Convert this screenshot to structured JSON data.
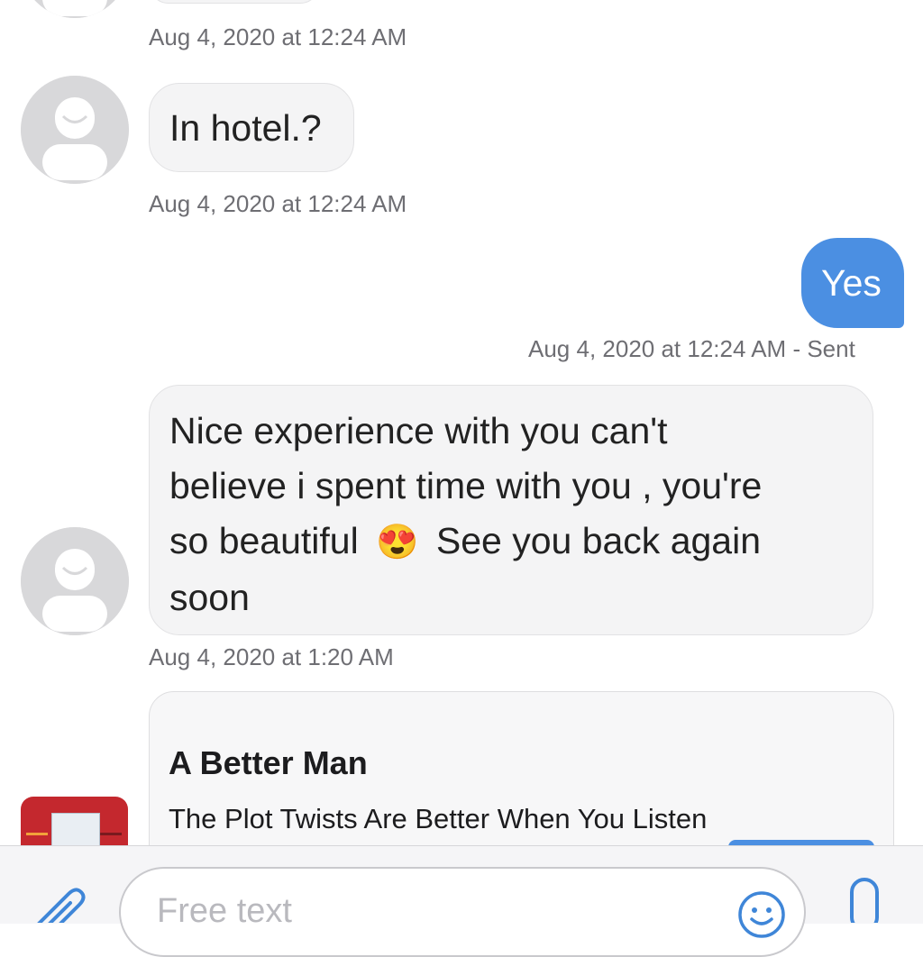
{
  "messages": [
    {
      "timestamp": "Aug 4, 2020 at 12:24 AM"
    },
    {
      "text": "In hotel.?",
      "timestamp": "Aug 4, 2020 at 12:24 AM"
    },
    {
      "text": "Yes",
      "timestamp": "Aug 4, 2020 at 12:24 AM - Sent"
    },
    {
      "line1": "Nice experience with you can't",
      "line2": "believe i spent time with you , you're",
      "line3_before": "so beautiful",
      "emoji": "😍",
      "line3_after": "See you back again",
      "line4": "soon",
      "timestamp": "Aug 4, 2020 at 1:20 AM"
    }
  ],
  "link_card": {
    "title": "A Better Man",
    "subtitle": "The Plot Twists Are Better When You Listen"
  },
  "input": {
    "placeholder": "Free text"
  },
  "icons": {
    "attach": "paperclip-icon",
    "emoji": "smiley-icon",
    "mic": "microphone-icon",
    "avatar": "default-avatar-icon"
  },
  "colors": {
    "outgoing_bubble": "#4b8fe2",
    "incoming_bubble": "#f4f4f5",
    "timestamp": "#6e6e73",
    "accent": "#3f86d8"
  }
}
